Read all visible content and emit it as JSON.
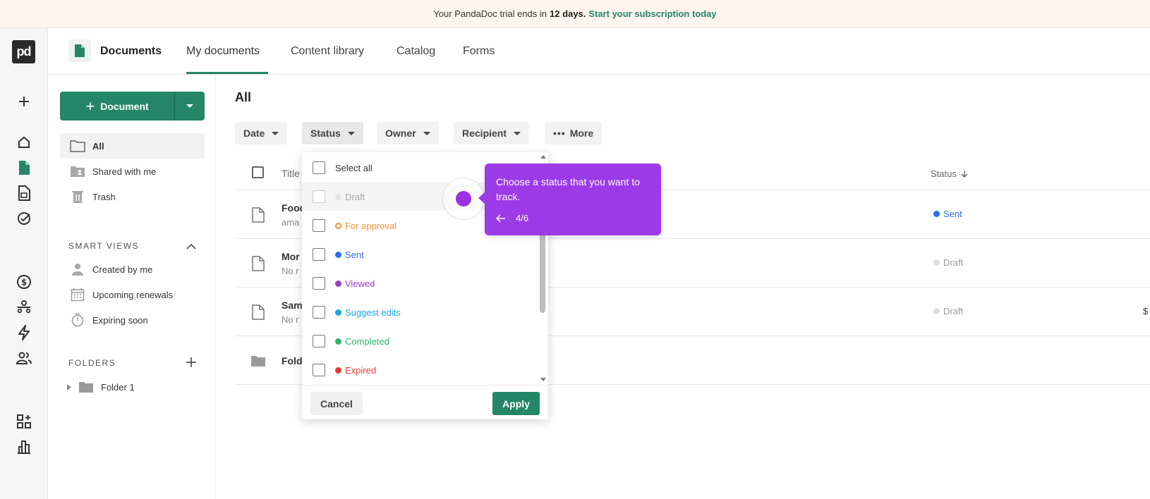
{
  "banner": {
    "prefix": "Your PandaDoc trial ends in",
    "days": "12 days.",
    "link": "Start your subscription today"
  },
  "rail": {
    "logo": "pd",
    "icons": [
      "plus-icon",
      "home-icon",
      "documents-icon",
      "templates-icon",
      "tasks-icon",
      "billing-icon",
      "contacts-org-icon",
      "automation-icon",
      "contacts-icon",
      "add-apps-icon",
      "reports-icon"
    ]
  },
  "topnav": {
    "title": "Documents",
    "tabs": [
      {
        "label": "My documents",
        "active": true
      },
      {
        "label": "Content library",
        "active": false
      },
      {
        "label": "Catalog",
        "active": false
      },
      {
        "label": "Forms",
        "active": false
      }
    ]
  },
  "sidebar": {
    "new_button": "Document",
    "items": [
      {
        "label": "All",
        "active": true
      },
      {
        "label": "Shared with me"
      },
      {
        "label": "Trash"
      }
    ],
    "smart_views_heading": "SMART VIEWS",
    "smart_views": [
      {
        "label": "Created by me"
      },
      {
        "label": "Upcoming renewals"
      },
      {
        "label": "Expiring soon"
      }
    ],
    "folders_heading": "FOLDERS",
    "folders": [
      {
        "label": "Folder 1"
      }
    ]
  },
  "main": {
    "title": "All",
    "filters": [
      {
        "label": "Date"
      },
      {
        "label": "Status"
      },
      {
        "label": "Owner"
      },
      {
        "label": "Recipient"
      },
      {
        "label": "More"
      }
    ],
    "columns": {
      "title": "Title",
      "status": "Status"
    },
    "rows": [
      {
        "name": "Food",
        "sub": "ama",
        "status": "Sent",
        "status_color": "#2b6fe8"
      },
      {
        "name": "Mor",
        "sub": "No r",
        "status": "Draft",
        "status_color": "#d0d0d0"
      },
      {
        "name": "Sam",
        "sub": "No r",
        "status": "Draft",
        "status_color": "#d0d0d0",
        "extra": "$"
      },
      {
        "name": "Fold",
        "sub": ""
      }
    ]
  },
  "status_dropdown": {
    "select_all": "Select all",
    "options": [
      {
        "label": "Draft",
        "color": "#a8a8a8",
        "dot": "#e4e4e4"
      },
      {
        "label": "For approval",
        "color": "#f0923a",
        "dot": "ring"
      },
      {
        "label": "Sent",
        "color": "#2b6fe8",
        "dot": "#2b6fe8"
      },
      {
        "label": "Viewed",
        "color": "#9b3fc4",
        "dot": "#9b3fc4"
      },
      {
        "label": "Suggest edits",
        "color": "#1ba6e0",
        "dot": "#1ba6e0"
      },
      {
        "label": "Completed",
        "color": "#2fb36a",
        "dot": "#2fb36a"
      },
      {
        "label": "Expired",
        "color": "#e23b3b",
        "dot": "#e23b3b"
      }
    ],
    "cancel": "Cancel",
    "apply": "Apply"
  },
  "tooltip": {
    "text": "Choose a status that you want to track.",
    "step": "4/6"
  },
  "colors": {
    "brand": "#248567",
    "tooltip": "#9b3ae6"
  }
}
